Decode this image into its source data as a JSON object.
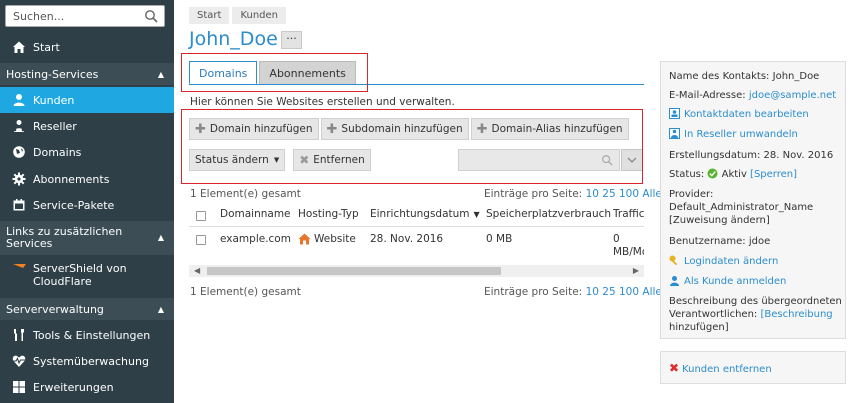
{
  "search": {
    "placeholder": "Suchen..."
  },
  "sidebar": {
    "start": "Start",
    "hosting_services": "Hosting-Services",
    "items": [
      {
        "label": "Kunden",
        "icon": "user-icon"
      },
      {
        "label": "Reseller",
        "icon": "reseller-icon"
      },
      {
        "label": "Domains",
        "icon": "globe-icon"
      },
      {
        "label": "Abonnements",
        "icon": "gear-icon"
      },
      {
        "label": "Service-Pakete",
        "icon": "calendar-icon"
      }
    ],
    "links_header": "Links zu zusätzlichen Services",
    "servershield": "ServerShield von CloudFlare",
    "server_admin": "Serververwaltung",
    "server_items": [
      {
        "label": "Tools & Einstellungen",
        "icon": "tools-icon"
      },
      {
        "label": "Systemüberwachung",
        "icon": "heartbeat-icon"
      },
      {
        "label": "Erweiterungen",
        "icon": "puzzle-icon"
      }
    ]
  },
  "breadcrumb": [
    "Start",
    "Kunden"
  ],
  "page_title": "John_Doe",
  "more_label": "···",
  "tabs": [
    "Domains",
    "Abonnements"
  ],
  "description": "Hier können Sie Websites erstellen und verwalten.",
  "toolbar": {
    "add_domain": "Domain hinzufügen",
    "add_subdomain": "Subdomain hinzufügen",
    "add_alias": "Domain-Alias hinzufügen",
    "change_status": "Status ändern",
    "remove": "Entfernen"
  },
  "list": {
    "total_top": "1 Element(e) gesamt",
    "total_bottom": "1 Element(e) gesamt",
    "per_page_label": "Einträge pro Seite:",
    "per_page_options": [
      "10",
      "25",
      "100",
      "Alle"
    ],
    "columns": [
      "Domainname",
      "Hosting-Typ",
      "Einrichtungsdatum",
      "Speicherplatzverbrauch",
      "Traffic"
    ],
    "rows": [
      {
        "domain": "example.com",
        "hosting": "Website",
        "date": "28. Nov. 2016",
        "disk": "0 MB",
        "traffic_1": "0",
        "traffic_2": "MB/Mo"
      }
    ]
  },
  "details": {
    "contact_name_label": "Name des Kontakts:",
    "contact_name": "John_Doe",
    "email_label": "E-Mail-Adresse:",
    "email": "jdoe@sample.net",
    "edit_contact": "Kontaktdaten bearbeiten",
    "convert_reseller": "In Reseller umwandeln",
    "created_label": "Erstellungsdatum:",
    "created": "28. Nov. 2016",
    "status_label": "Status:",
    "status": "Aktiv",
    "suspend": "[Sperren]",
    "provider_label": "Provider:",
    "provider": "Default_Administrator_Name",
    "change_assignment": "[Zuweisung ändern]",
    "username_label": "Benutzername:",
    "username": "jdoe",
    "change_login": "Logindaten ändern",
    "login_as": "Als Kunde anmelden",
    "parent_desc_1": "Beschreibung des übergeordneten",
    "parent_desc_2": "Verantwortlichen:",
    "add_desc_1": "[Beschreibung",
    "add_desc_2": "hinzufügen]",
    "remove_customer": "Kunden entfernen"
  },
  "colors": {
    "accent": "#1fa7e1",
    "link": "#2b8dce",
    "sidebar": "#2e3f47",
    "highlight": "#d9252b"
  }
}
